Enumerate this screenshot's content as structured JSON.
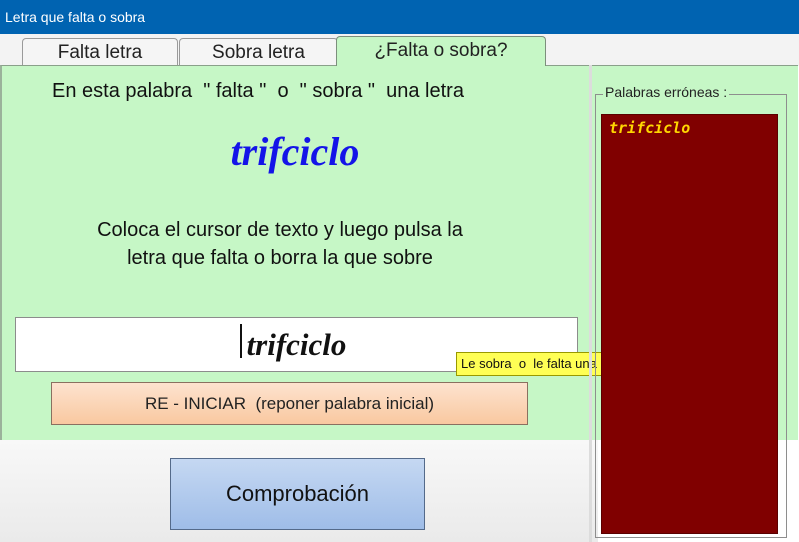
{
  "window": {
    "title": "Letra que falta o sobra"
  },
  "tabs": [
    {
      "label": "Falta letra"
    },
    {
      "label": "Sobra letra"
    },
    {
      "label": "¿Falta o sobra?"
    }
  ],
  "main": {
    "prompt": "En esta palabra  \" falta \"  o  \" sobra \"  una letra",
    "target_word": "trifciclo",
    "instructions": "Coloca el cursor de texto y luego pulsa la letra que falta o borra la que sobre",
    "input_value": "trifciclo",
    "tooltip": "Le sobra  o  le falta una letra",
    "reset_button": "RE - INICIAR  (reponer palabra inicial)",
    "check_button": "Comprobación"
  },
  "errors": {
    "legend": "Palabras erróneas :",
    "items": [
      "trifciclo"
    ]
  },
  "colors": {
    "titlebar": "#0063b1",
    "panel_green": "#c6f7c6",
    "target_word": "#1414e8",
    "error_list_bg": "#800000",
    "error_text": "#ffd700",
    "tooltip_bg": "#ffff55"
  }
}
